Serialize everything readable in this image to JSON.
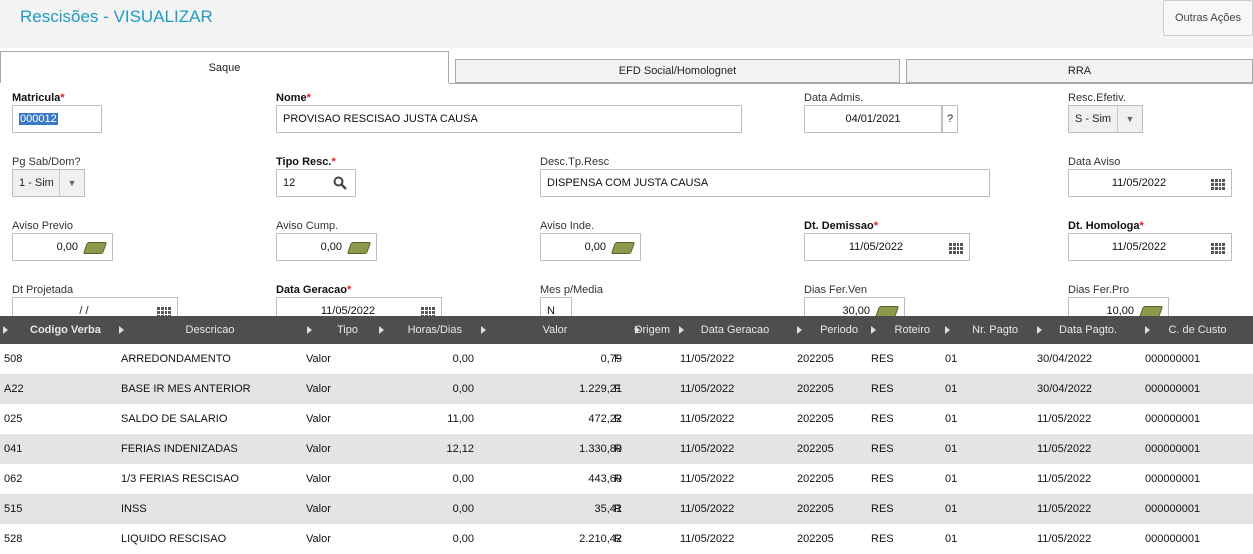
{
  "header": {
    "title": "Rescisões - VISUALIZAR",
    "outras_acoes": "Outras Ações"
  },
  "tabs": [
    {
      "label": "Saque",
      "active": true
    },
    {
      "label": "EFD Social/Homolognet",
      "active": false
    },
    {
      "label": "RRA",
      "active": false
    }
  ],
  "form": {
    "matricula": {
      "label": "Matricula",
      "value": "000012"
    },
    "nome": {
      "label": "Nome",
      "value": "PROVISAO RESCISAO JUSTA CAUSA"
    },
    "data_admis": {
      "label": "Data Admis.",
      "value": "04/01/2021",
      "help": "?"
    },
    "resc_efetiv": {
      "label": "Resc.Efetiv.",
      "value": "S - Sim"
    },
    "pg_sab_dom": {
      "label": "Pg Sab/Dom?",
      "value": "1 - Sim"
    },
    "tipo_resc": {
      "label": "Tipo Resc.",
      "value": "12"
    },
    "desc_tp_resc": {
      "label": "Desc.Tp.Resc",
      "value": "DISPENSA COM JUSTA CAUSA"
    },
    "data_aviso": {
      "label": "Data Aviso",
      "value": "11/05/2022"
    },
    "aviso_previo": {
      "label": "Aviso Previo",
      "value": "0,00"
    },
    "aviso_cump": {
      "label": "Aviso Cump.",
      "value": "0,00"
    },
    "aviso_inde": {
      "label": "Aviso Inde.",
      "value": "0,00"
    },
    "dt_demissao": {
      "label": "Dt. Demissao",
      "value": "11/05/2022"
    },
    "dt_homologa": {
      "label": "Dt. Homologa",
      "value": "11/05/2022"
    },
    "dt_projetada": {
      "label": "Dt Projetada",
      "value": "/ /"
    },
    "data_geracao": {
      "label": "Data Geracao",
      "value": "11/05/2022"
    },
    "mes_p_media": {
      "label": "Mes p/Media",
      "value": "N"
    },
    "dias_fer_ven": {
      "label": "Dias Fer.Ven",
      "value": "30,00"
    },
    "dias_fer_pro": {
      "label": "Dias Fer.Pro",
      "value": "10,00"
    }
  },
  "grid": {
    "columns": [
      "Codigo Verba",
      "Descricao",
      "Tipo",
      "Horas/Dias",
      "Valor",
      "Origem",
      "Data Geracao",
      "Periodo",
      "Roteiro",
      "Nr. Pagto",
      "Data Pagto.",
      "C. de Custo"
    ],
    "rows": [
      [
        "508",
        "ARREDONDAMENTO",
        "Valor",
        "0,00",
        "0,79",
        "F",
        "11/05/2022",
        "202205",
        "RES",
        "01",
        "30/04/2022",
        "000000001"
      ],
      [
        "A22",
        "BASE IR MES ANTERIOR",
        "Valor",
        "0,00",
        "1.229,21",
        "F",
        "11/05/2022",
        "202205",
        "RES",
        "01",
        "30/04/2022",
        "000000001"
      ],
      [
        "025",
        "SALDO DE SALARIO",
        "Valor",
        "11,00",
        "472,22",
        "R",
        "11/05/2022",
        "202205",
        "RES",
        "01",
        "11/05/2022",
        "000000001"
      ],
      [
        "041",
        "FERIAS INDENIZADAS",
        "Valor",
        "12,12",
        "1.330,80",
        "R",
        "11/05/2022",
        "202205",
        "RES",
        "01",
        "11/05/2022",
        "000000001"
      ],
      [
        "062",
        "1/3 FERIAS RESCISAO",
        "Valor",
        "0,00",
        "443,60",
        "R",
        "11/05/2022",
        "202205",
        "RES",
        "01",
        "11/05/2022",
        "000000001"
      ],
      [
        "515",
        "INSS",
        "Valor",
        "0,00",
        "35,41",
        "R",
        "11/05/2022",
        "202205",
        "RES",
        "01",
        "11/05/2022",
        "000000001"
      ],
      [
        "528",
        "LIQUIDO RESCISAO",
        "Valor",
        "0,00",
        "2.210,42",
        "R",
        "11/05/2022",
        "202205",
        "RES",
        "01",
        "11/05/2022",
        "000000001"
      ]
    ]
  }
}
